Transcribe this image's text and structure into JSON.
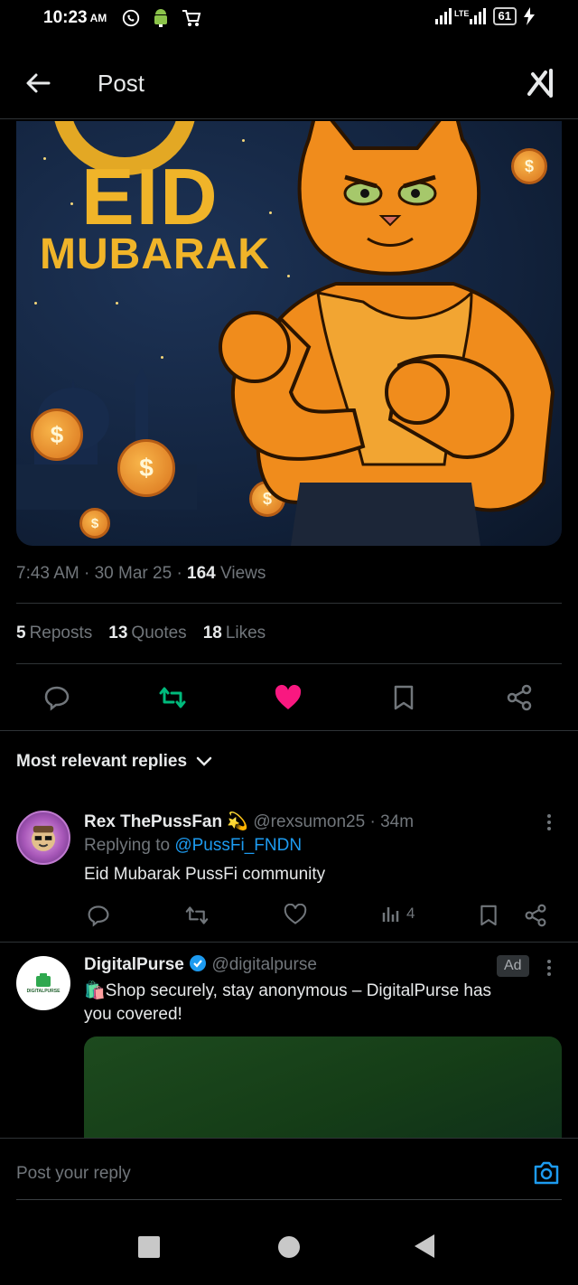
{
  "status_bar": {
    "time": "10:23",
    "ampm": "AM",
    "battery": "61",
    "network": "LTE",
    "icons": [
      "whatsapp-icon",
      "android-icon",
      "cart-icon",
      "signal-icon",
      "battery-icon",
      "charging-icon"
    ]
  },
  "header": {
    "title": "Post",
    "back_icon": "arrow-left-icon",
    "grok_icon": "grok-icon"
  },
  "media": {
    "line1": "EID",
    "line2": "MUBARAK",
    "coin_symbol": "$"
  },
  "post_meta": {
    "time": "7:43 AM",
    "sep": "·",
    "date": "30 Mar 25",
    "views_count": "164",
    "views_label": "Views"
  },
  "post_stats": {
    "reposts_count": "5",
    "reposts_label": "Reposts",
    "quotes_count": "13",
    "quotes_label": "Quotes",
    "likes_count": "18",
    "likes_label": "Likes"
  },
  "action_colors": {
    "repost": "#00ba7c",
    "like": "#f91880",
    "default": "#71767b"
  },
  "sort": {
    "label": "Most relevant replies"
  },
  "replies": [
    {
      "name": "Rex ThePussFan",
      "emoji": "💫",
      "handle": "@rexsumon25",
      "sep": "·",
      "time": "34m",
      "replying_prefix": "Replying to",
      "replying_to": "@PussFi_FNDN",
      "text": "Eid Mubarak PussFi community",
      "views": "4"
    }
  ],
  "ad": {
    "name": "DigitalPurse",
    "handle": "@digitalpurse",
    "badge": "Ad",
    "logo_text": "DIGITALPURSE",
    "emoji": "🛍️",
    "text_line1": "Shop securely, stay anonymous – DigitalPurse has",
    "text_line2": "you covered!",
    "verified_color": "#1d9bf0"
  },
  "reply_box": {
    "placeholder": "Post your reply"
  }
}
